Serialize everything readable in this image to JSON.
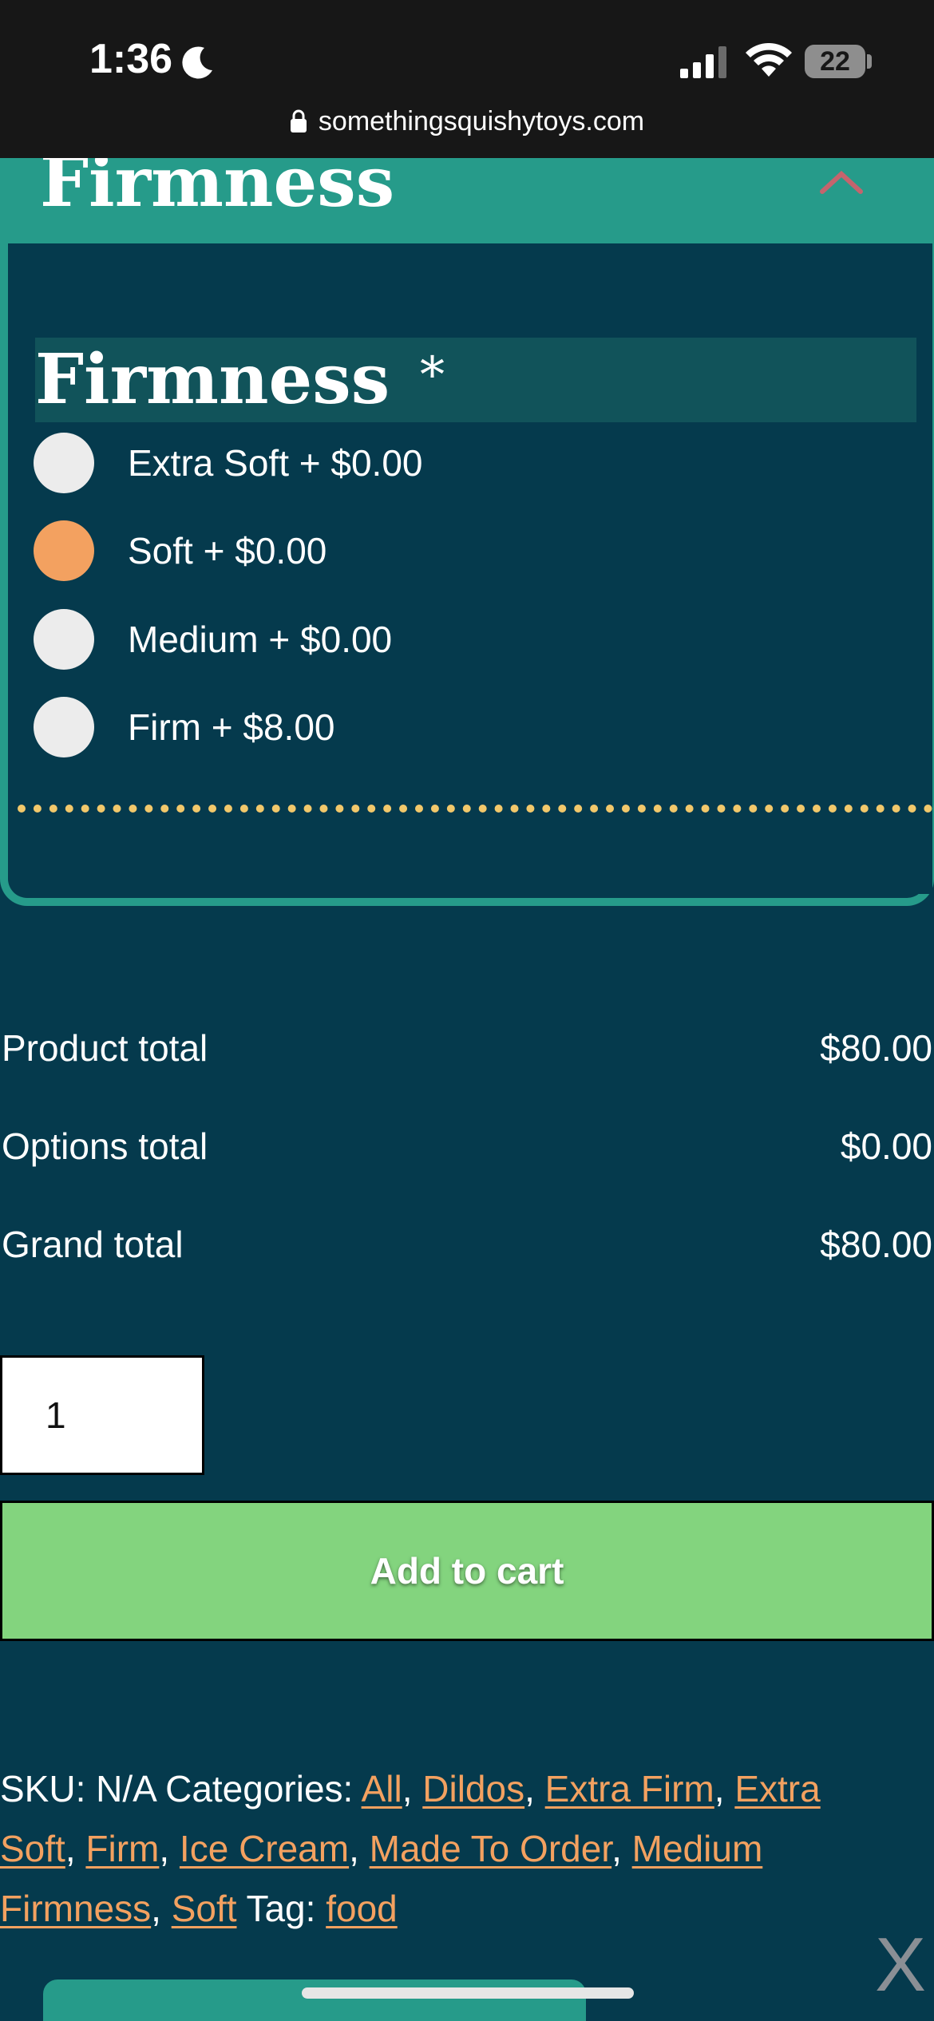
{
  "status_bar": {
    "time": "1:36",
    "battery": "22",
    "url": "somethingsquishytoys.com"
  },
  "accordion": {
    "title": "Firmness",
    "icon": "chevron-up-icon"
  },
  "field": {
    "label": "Firmness",
    "required_mark": "*",
    "options": [
      {
        "label": "Extra Soft + $0.00",
        "checked": false
      },
      {
        "label": "Soft + $0.00",
        "checked": true
      },
      {
        "label": "Medium + $0.00",
        "checked": false
      },
      {
        "label": "Firm + $8.00",
        "checked": false
      }
    ]
  },
  "totals": {
    "product_label": "Product total",
    "product_value": "$80.00",
    "options_label": "Options total",
    "options_value": "$0.00",
    "grand_label": "Grand total",
    "grand_value": "$80.00"
  },
  "quantity": "1",
  "add_to_cart_label": "Add to cart",
  "meta": {
    "sku_label": "SKU:",
    "sku_value": "N/A",
    "categories_label": "Categories:",
    "categories": [
      "All",
      "Dildos",
      "Extra Firm",
      "Extra Soft",
      "Firm",
      "Ice Cream",
      "Made To Order",
      "Medium Firmness",
      "Soft"
    ],
    "tag_label": "Tag:",
    "tag": "food"
  },
  "close_label": "X",
  "colors": {
    "background": "#053a4d",
    "accent_teal": "#269b8a",
    "selected_radio": "#f3a160",
    "link": "#f3a160",
    "button": "#83d47e",
    "divider": "#f2c86b"
  }
}
